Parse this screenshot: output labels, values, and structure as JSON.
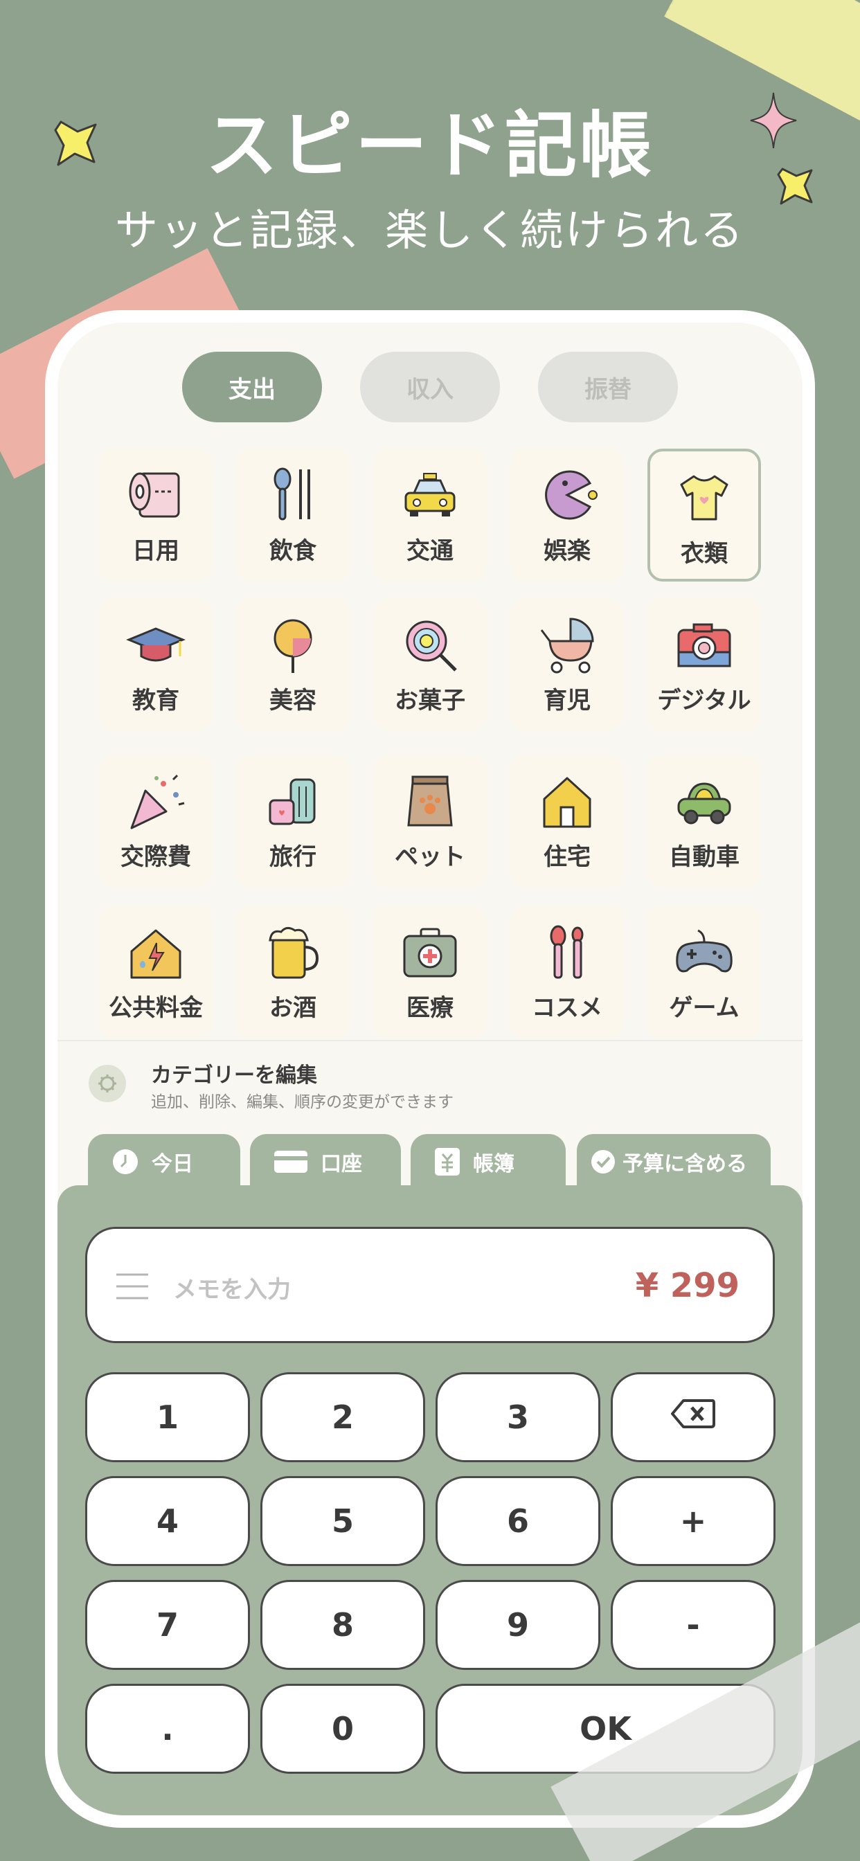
{
  "headline": "スピード記帳",
  "subline": "サッと記録、楽しく続けられる",
  "type_tabs": [
    {
      "label": "支出",
      "active": true
    },
    {
      "label": "収入",
      "active": false
    },
    {
      "label": "振替",
      "active": false
    }
  ],
  "categories": [
    {
      "label": "日用",
      "icon": "toilet-paper-icon"
    },
    {
      "label": "飲食",
      "icon": "cutlery-icon"
    },
    {
      "label": "交通",
      "icon": "taxi-icon"
    },
    {
      "label": "娯楽",
      "icon": "pacman-icon"
    },
    {
      "label": "衣類",
      "icon": "tshirt-icon",
      "selected": true
    },
    {
      "label": "教育",
      "icon": "graduation-cap-icon"
    },
    {
      "label": "美容",
      "icon": "candy-apple-icon"
    },
    {
      "label": "お菓子",
      "icon": "lollipop-icon"
    },
    {
      "label": "育児",
      "icon": "stroller-icon"
    },
    {
      "label": "デジタル",
      "icon": "camera-icon"
    },
    {
      "label": "交際費",
      "icon": "party-popper-icon"
    },
    {
      "label": "旅行",
      "icon": "luggage-icon"
    },
    {
      "label": "ペット",
      "icon": "pet-food-icon"
    },
    {
      "label": "住宅",
      "icon": "house-icon"
    },
    {
      "label": "自動車",
      "icon": "car-icon"
    },
    {
      "label": "公共料金",
      "icon": "utilities-house-icon"
    },
    {
      "label": "お酒",
      "icon": "beer-icon"
    },
    {
      "label": "医療",
      "icon": "first-aid-icon"
    },
    {
      "label": "コスメ",
      "icon": "makeup-brush-icon"
    },
    {
      "label": "ゲーム",
      "icon": "gamepad-icon"
    }
  ],
  "edit_category": {
    "title": "カテゴリーを編集",
    "subtitle": "追加、削除、編集、順序の変更ができます"
  },
  "panel_tabs": [
    {
      "label": "今日",
      "icon": "clock-icon"
    },
    {
      "label": "口座",
      "icon": "card-icon"
    },
    {
      "label": "帳簿",
      "icon": "ledger-icon"
    },
    {
      "label": "予算に含める",
      "icon": "check-circle-icon"
    }
  ],
  "memo": {
    "placeholder": "メモを入力",
    "amount": "¥ 299"
  },
  "keypad": [
    "1",
    "2",
    "3",
    "⌫",
    "4",
    "5",
    "6",
    "+",
    "7",
    "8",
    "9",
    "-",
    ".",
    "0",
    "OK"
  ],
  "colors": {
    "background": "#8fa28d",
    "accent": "#8fa28d",
    "panel": "#a4b6a0",
    "amount": "#c0625c"
  }
}
